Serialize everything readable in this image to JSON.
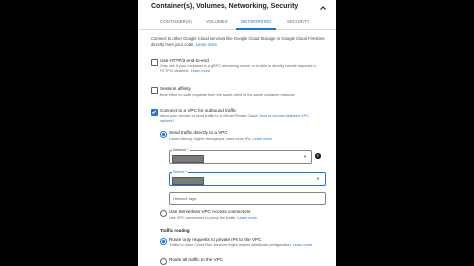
{
  "header": {
    "title": "Container(s), Volumes, Networking, Security"
  },
  "tabs": [
    {
      "label": "CONTAINER(S)"
    },
    {
      "label": "VOLUMES"
    },
    {
      "label": "NETWORKING"
    },
    {
      "label": "SECURITY"
    }
  ],
  "intro": {
    "line1": "Connect to other Google Cloud services like Google Cloud Storage or Google Cloud Firestore",
    "line2": "directly from your code.",
    "learn_more": "Learn more"
  },
  "http2": {
    "label": "Use HTTP/2 end-to-end",
    "desc1": "Only use if your container is a gRPC streaming server or is able to directly handle requests in",
    "desc2": "HTTP/2 cleartext.",
    "learn_more": "Learn more"
  },
  "session": {
    "label": "Session affinity",
    "desc": "Best effort to route requests from the same client to the same container instance."
  },
  "vpc": {
    "label_pre": "Connect to a VPC for outbound traffic",
    "desc_pre": "Allow your service to send traffic to a Virtual Private Cloud.",
    "desc_link": "How to choose between VPC",
    "desc_link2": "options?"
  },
  "direct": {
    "label": "Send traffic directly to a VPC",
    "desc": "Lower latency, higher throughput, uses more IPs.",
    "learn_more": "Learn more"
  },
  "network": {
    "label": "Network *"
  },
  "subnet": {
    "label": "Subnet *"
  },
  "tags": {
    "placeholder": "Network tags"
  },
  "serverless": {
    "label": "Use Serverless VPC Access connectors",
    "desc": "Use VPC connectors to proxy the traffic.",
    "learn_more": "Learn more"
  },
  "routing": {
    "title": "Traffic routing",
    "private_label": "Route only requests to private IPs to the VPC",
    "private_desc1": "Traffic to other Cloud Run services might require additional configuration.",
    "learn_more": "Learn more",
    "all_label": "Route all traffic to the VPC"
  },
  "colors": {
    "accent": "#1a73e8",
    "background": "#000000"
  }
}
